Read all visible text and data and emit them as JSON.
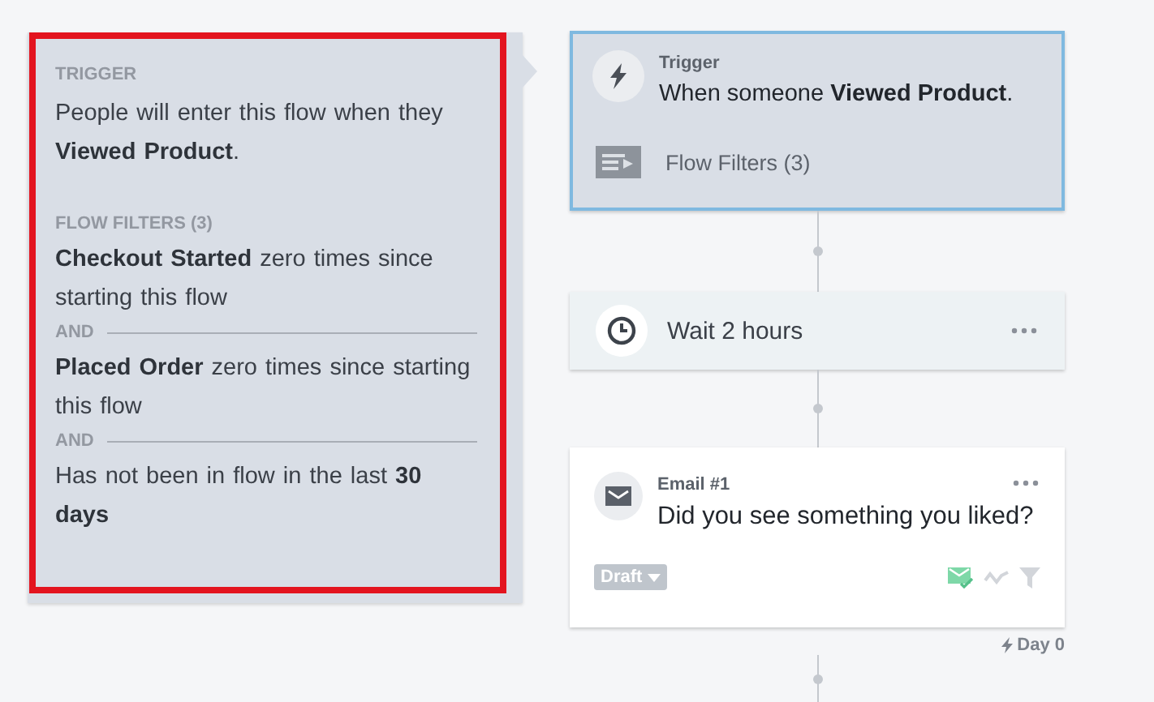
{
  "filters_panel": {
    "highlighted": true,
    "trigger_heading": "TRIGGER",
    "trigger_text": "People will enter this flow when they **Viewed Product**.",
    "filters_heading": "FLOW FILTERS (3)",
    "filters": [
      {
        "text": "**Checkout Started** zero times since starting this flow"
      },
      {
        "separator": "AND",
        "text": "**Placed Order** zero times since starting this flow"
      },
      {
        "separator": "AND",
        "text": "Has not been in flow in the last **30 days**"
      }
    ]
  },
  "flow": [
    {
      "kind": "trigger",
      "selected": true,
      "label": "Trigger",
      "text": "When someone **Viewed Product**.",
      "filters_label": "Flow Filters (3)"
    },
    {
      "kind": "delay",
      "selected": false,
      "text": "Wait 2 hours"
    },
    {
      "kind": "email",
      "selected": false,
      "label": "Email #1",
      "text": "Did you see something you liked?",
      "status": "Draft",
      "day": "Day 0"
    }
  ]
}
